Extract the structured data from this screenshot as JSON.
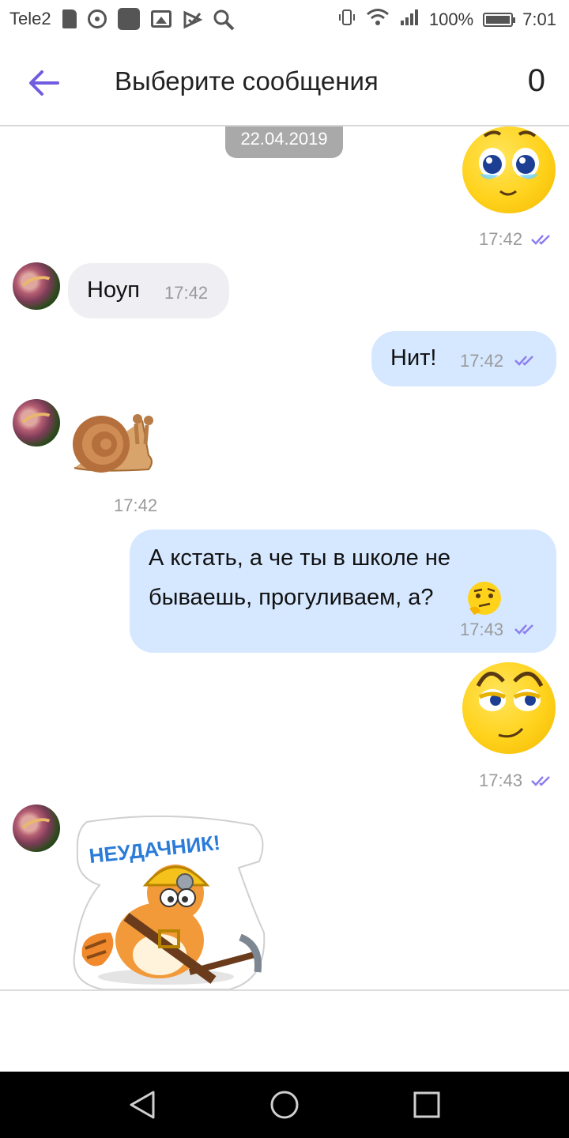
{
  "status_bar": {
    "carrier": "Tele2",
    "battery": "100%",
    "time": "7:01"
  },
  "header": {
    "title": "Выберите сообщения",
    "selected_count": "0"
  },
  "chat": {
    "date": "22.04.2019",
    "messages": [
      {
        "direction": "out",
        "type": "sticker",
        "sticker": "pleading-face",
        "time": "17:42"
      },
      {
        "direction": "in",
        "type": "text",
        "text": "Ноуп",
        "time": "17:42"
      },
      {
        "direction": "out",
        "type": "text",
        "text": "Нит!",
        "time": "17:42"
      },
      {
        "direction": "in",
        "type": "sticker",
        "sticker": "snail",
        "time": "17:42"
      },
      {
        "direction": "out",
        "type": "text",
        "text": "А кстать, а че ты в школе не бываешь, прогуливаем, а?",
        "line1": "А кстать, а че ты в школе не",
        "line2": "бываешь, прогуливаем, а?",
        "emoji": "thinking-face",
        "time": "17:43"
      },
      {
        "direction": "out",
        "type": "sticker",
        "sticker": "smirking-eyes-face",
        "time": "17:43"
      },
      {
        "direction": "in",
        "type": "sticker",
        "sticker": "cat-miner",
        "sticker_text": "НЕУДАЧНИК!"
      }
    ]
  },
  "colors": {
    "accent": "#6f5ce0",
    "outgoing_bubble": "#d6e8ff",
    "incoming_bubble": "#efeef2",
    "date_chip": "#a9a9a9"
  }
}
